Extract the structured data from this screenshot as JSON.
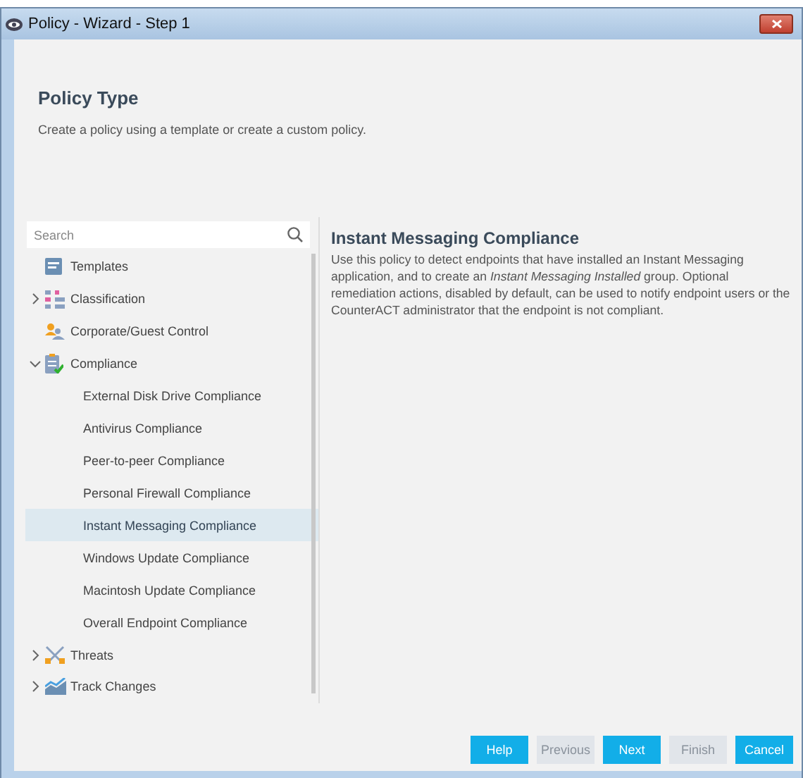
{
  "window": {
    "title": "Policy - Wizard - Step 1"
  },
  "header": {
    "title": "Policy Type",
    "description": "Create a policy using a template or create a custom policy."
  },
  "search": {
    "placeholder": "Search"
  },
  "tree": [
    {
      "label": "Templates",
      "expandable": false,
      "expanded": false,
      "selected": false
    },
    {
      "label": "Classification",
      "expandable": true,
      "expanded": false,
      "selected": false
    },
    {
      "label": "Corporate/Guest Control",
      "expandable": false,
      "expanded": false,
      "selected": false
    },
    {
      "label": "Compliance",
      "expandable": true,
      "expanded": true,
      "selected": false,
      "children": [
        {
          "label": "External Disk Drive Compliance",
          "selected": false
        },
        {
          "label": "Antivirus Compliance",
          "selected": false
        },
        {
          "label": "Peer-to-peer Compliance",
          "selected": false
        },
        {
          "label": "Personal Firewall Compliance",
          "selected": false
        },
        {
          "label": "Instant Messaging Compliance",
          "selected": true
        },
        {
          "label": "Windows Update Compliance",
          "selected": false
        },
        {
          "label": "Macintosh Update Compliance",
          "selected": false
        },
        {
          "label": "Overall Endpoint Compliance",
          "selected": false
        }
      ]
    },
    {
      "label": "Threats",
      "expandable": true,
      "expanded": false,
      "selected": false
    },
    {
      "label": "Track Changes",
      "expandable": true,
      "expanded": false,
      "selected": false
    }
  ],
  "detail": {
    "title": "Instant Messaging Compliance",
    "description": "Use this policy to detect endpoints that have installed an Instant Messaging application, and to create an *Instant Messaging Installed* group. Optional remediation actions, disabled by default, can be used to notify endpoint users or the CounterACT administrator that the endpoint is not compliant."
  },
  "buttons": [
    {
      "label": "Help",
      "disabled": false
    },
    {
      "label": "Previous",
      "disabled": true
    },
    {
      "label": "Next",
      "disabled": false
    },
    {
      "label": "Finish",
      "disabled": true
    },
    {
      "label": "Cancel",
      "disabled": false
    }
  ]
}
